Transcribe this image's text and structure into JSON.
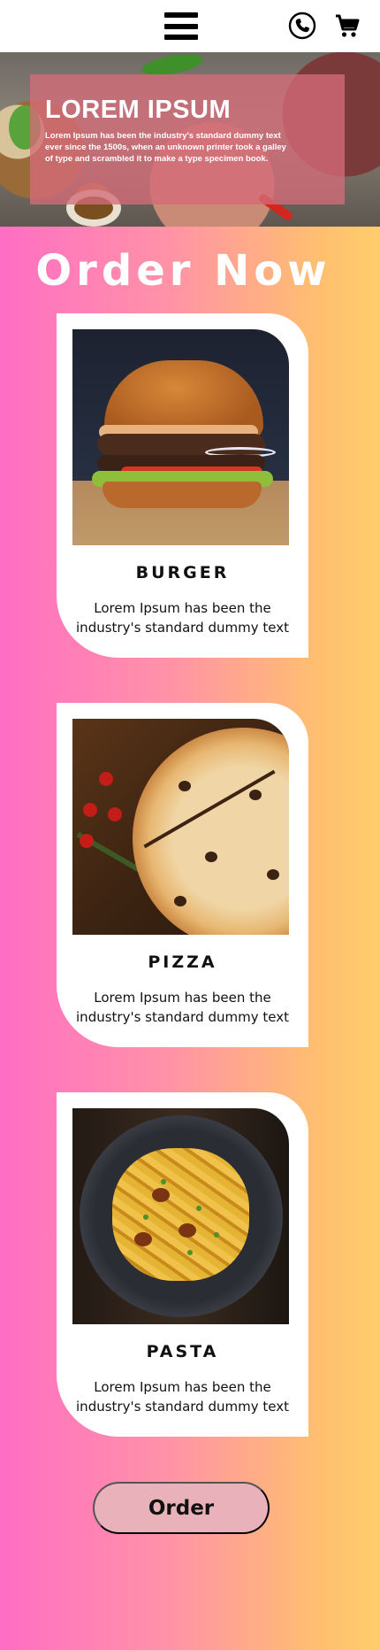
{
  "header": {
    "menu_icon": "hamburger-menu-icon",
    "phone_icon": "phone-icon",
    "cart_icon": "shopping-cart-icon"
  },
  "hero": {
    "title": "LOREM IPSUM",
    "text": "Lorem Ipsum has been the industry's standard dummy text ever since the 1500s, when an unknown printer took a galley of type and scrambled it to make a type specimen book."
  },
  "main": {
    "heading": "Order Now",
    "cards": [
      {
        "name": "BURGER",
        "description": "Lorem Ipsum has been the industry's standard dummy text"
      },
      {
        "name": "PIZZA",
        "description": "Lorem Ipsum has been the industry's standard dummy text"
      },
      {
        "name": "PASTA",
        "description": "Lorem Ipsum has been the industry's standard dummy text"
      }
    ]
  },
  "footer": {
    "order_label": "Order"
  },
  "colors": {
    "gradient_left": "#ff6ec4",
    "gradient_right": "#ffcd6b",
    "hero_overlay": "#d56c78",
    "order_button": "#e9b2ba"
  }
}
